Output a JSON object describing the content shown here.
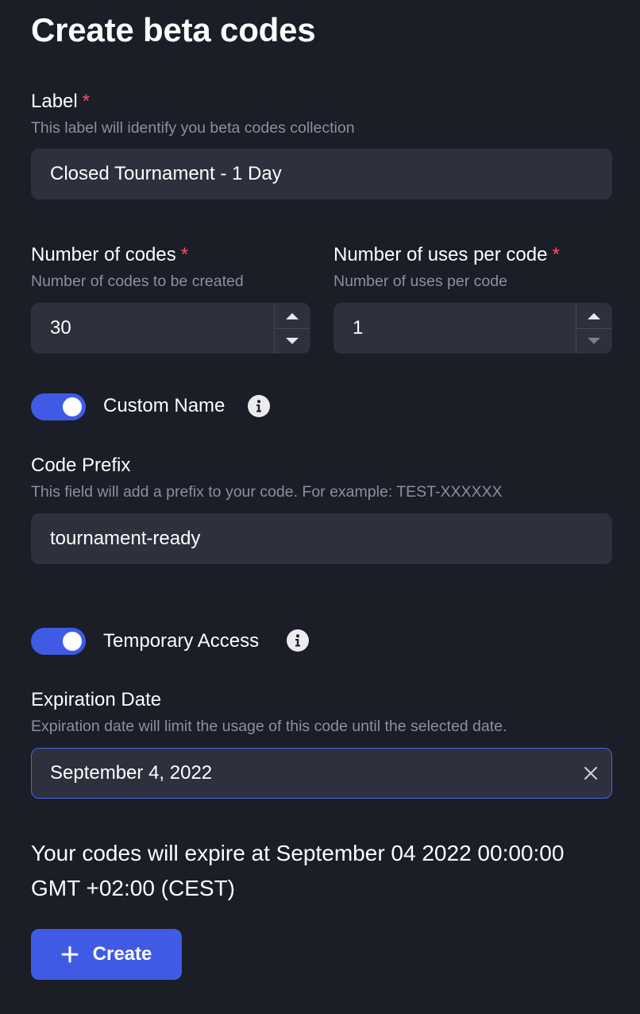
{
  "page": {
    "title": "Create beta codes"
  },
  "label_field": {
    "label": "Label",
    "required_mark": "*",
    "help": "This label will identify you beta codes collection",
    "value": "Closed Tournament - 1 Day"
  },
  "codes_field": {
    "label": "Number of codes",
    "required_mark": "*",
    "help": "Number of codes to be created",
    "value": "30"
  },
  "uses_field": {
    "label": "Number of uses per code",
    "required_mark": "*",
    "help": "Number of uses per code",
    "value": "1"
  },
  "custom_name": {
    "toggle_label": "Custom Name",
    "enabled": true,
    "icon": "info-icon"
  },
  "prefix_field": {
    "label": "Code Prefix",
    "help": "This field will add a prefix to your code. For example: TEST-XXXXXX",
    "value": "tournament-ready"
  },
  "temporary_access": {
    "toggle_label": "Temporary Access",
    "enabled": true,
    "icon": "info-icon"
  },
  "expiration_field": {
    "label": "Expiration Date",
    "help": "Expiration date will limit the usage of this code until the selected date.",
    "value": "September 4, 2022",
    "clear_icon": "close-icon"
  },
  "expiry_notice": "Your codes will expire at September 04 2022 00:00:00 GMT +02:00 (CEST)",
  "create_button": {
    "label": "Create",
    "icon": "plus-icon"
  },
  "colors": {
    "background": "#1b1d27",
    "input": "#2d303d",
    "accent": "#3f5be6",
    "required": "#ff4d6a",
    "muted_text": "#8c909e"
  }
}
